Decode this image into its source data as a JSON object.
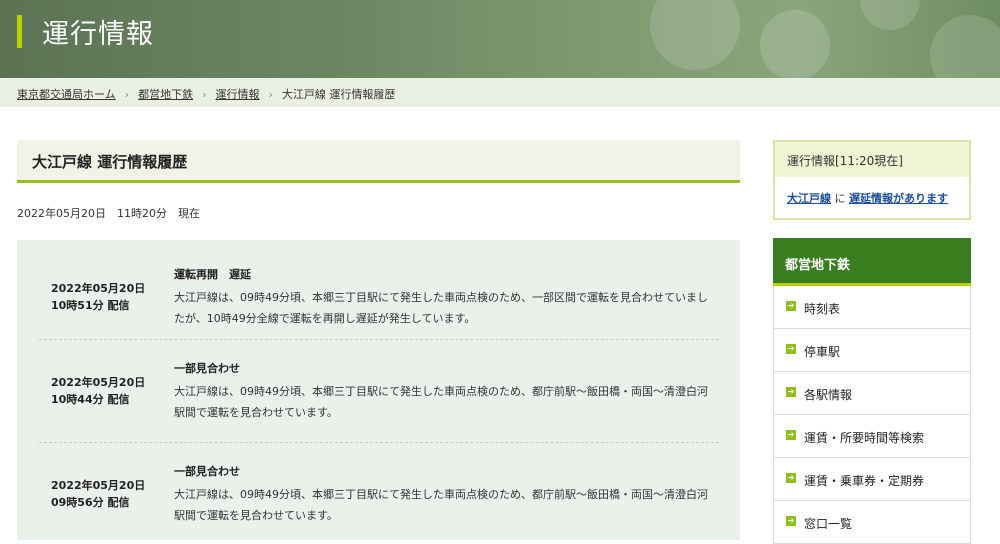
{
  "header": {
    "title": "運行情報"
  },
  "breadcrumb": [
    "東京都交通局ホーム",
    "都営地下鉄",
    "運行情報",
    "大江戸線 運行情報履歴"
  ],
  "main": {
    "heading": "大江戸線 運行情報履歴",
    "as_of": "2022年05月20日　11時20分　現在",
    "entries": [
      {
        "date": "2022年05月20日",
        "time": "10時51分 配信",
        "head": "運転再開　遅延",
        "body": "大江戸線は、09時49分頃、本郷三丁目駅にて発生した車両点検のため、一部区間で運転を見合わせていましたが、10時49分全線で運転を再開し遅延が発生しています。"
      },
      {
        "date": "2022年05月20日",
        "time": "10時44分 配信",
        "head": "一部見合わせ",
        "body": "大江戸線は、09時49分頃、本郷三丁目駅にて発生した車両点検のため、都庁前駅～飯田橋・両国～清澄白河駅間で運転を見合わせています。"
      },
      {
        "date": "2022年05月20日",
        "time": "09時56分 配信",
        "head": "一部見合わせ",
        "body": "大江戸線は、09時49分頃、本郷三丁目駅にて発生した車両点検のため、都庁前駅～飯田橋・両国～清澄白河駅間で運転を見合わせています。"
      }
    ]
  },
  "sidebar": {
    "status_title": "運行情報[11:20現在]",
    "status_line": "大江戸線",
    "status_mid": "に",
    "status_link": "遅延情報があります",
    "menu_title": "都営地下鉄",
    "menu": [
      "時刻表",
      "停車駅",
      "各駅情報",
      "運賃・所要時間等検索",
      "運賃・乗車券・定期券",
      "窓口一覧"
    ]
  },
  "colors": {
    "accent": "#b8d200",
    "menu_header": "#3a7d1e",
    "list_bg": "#e9f1ea"
  }
}
